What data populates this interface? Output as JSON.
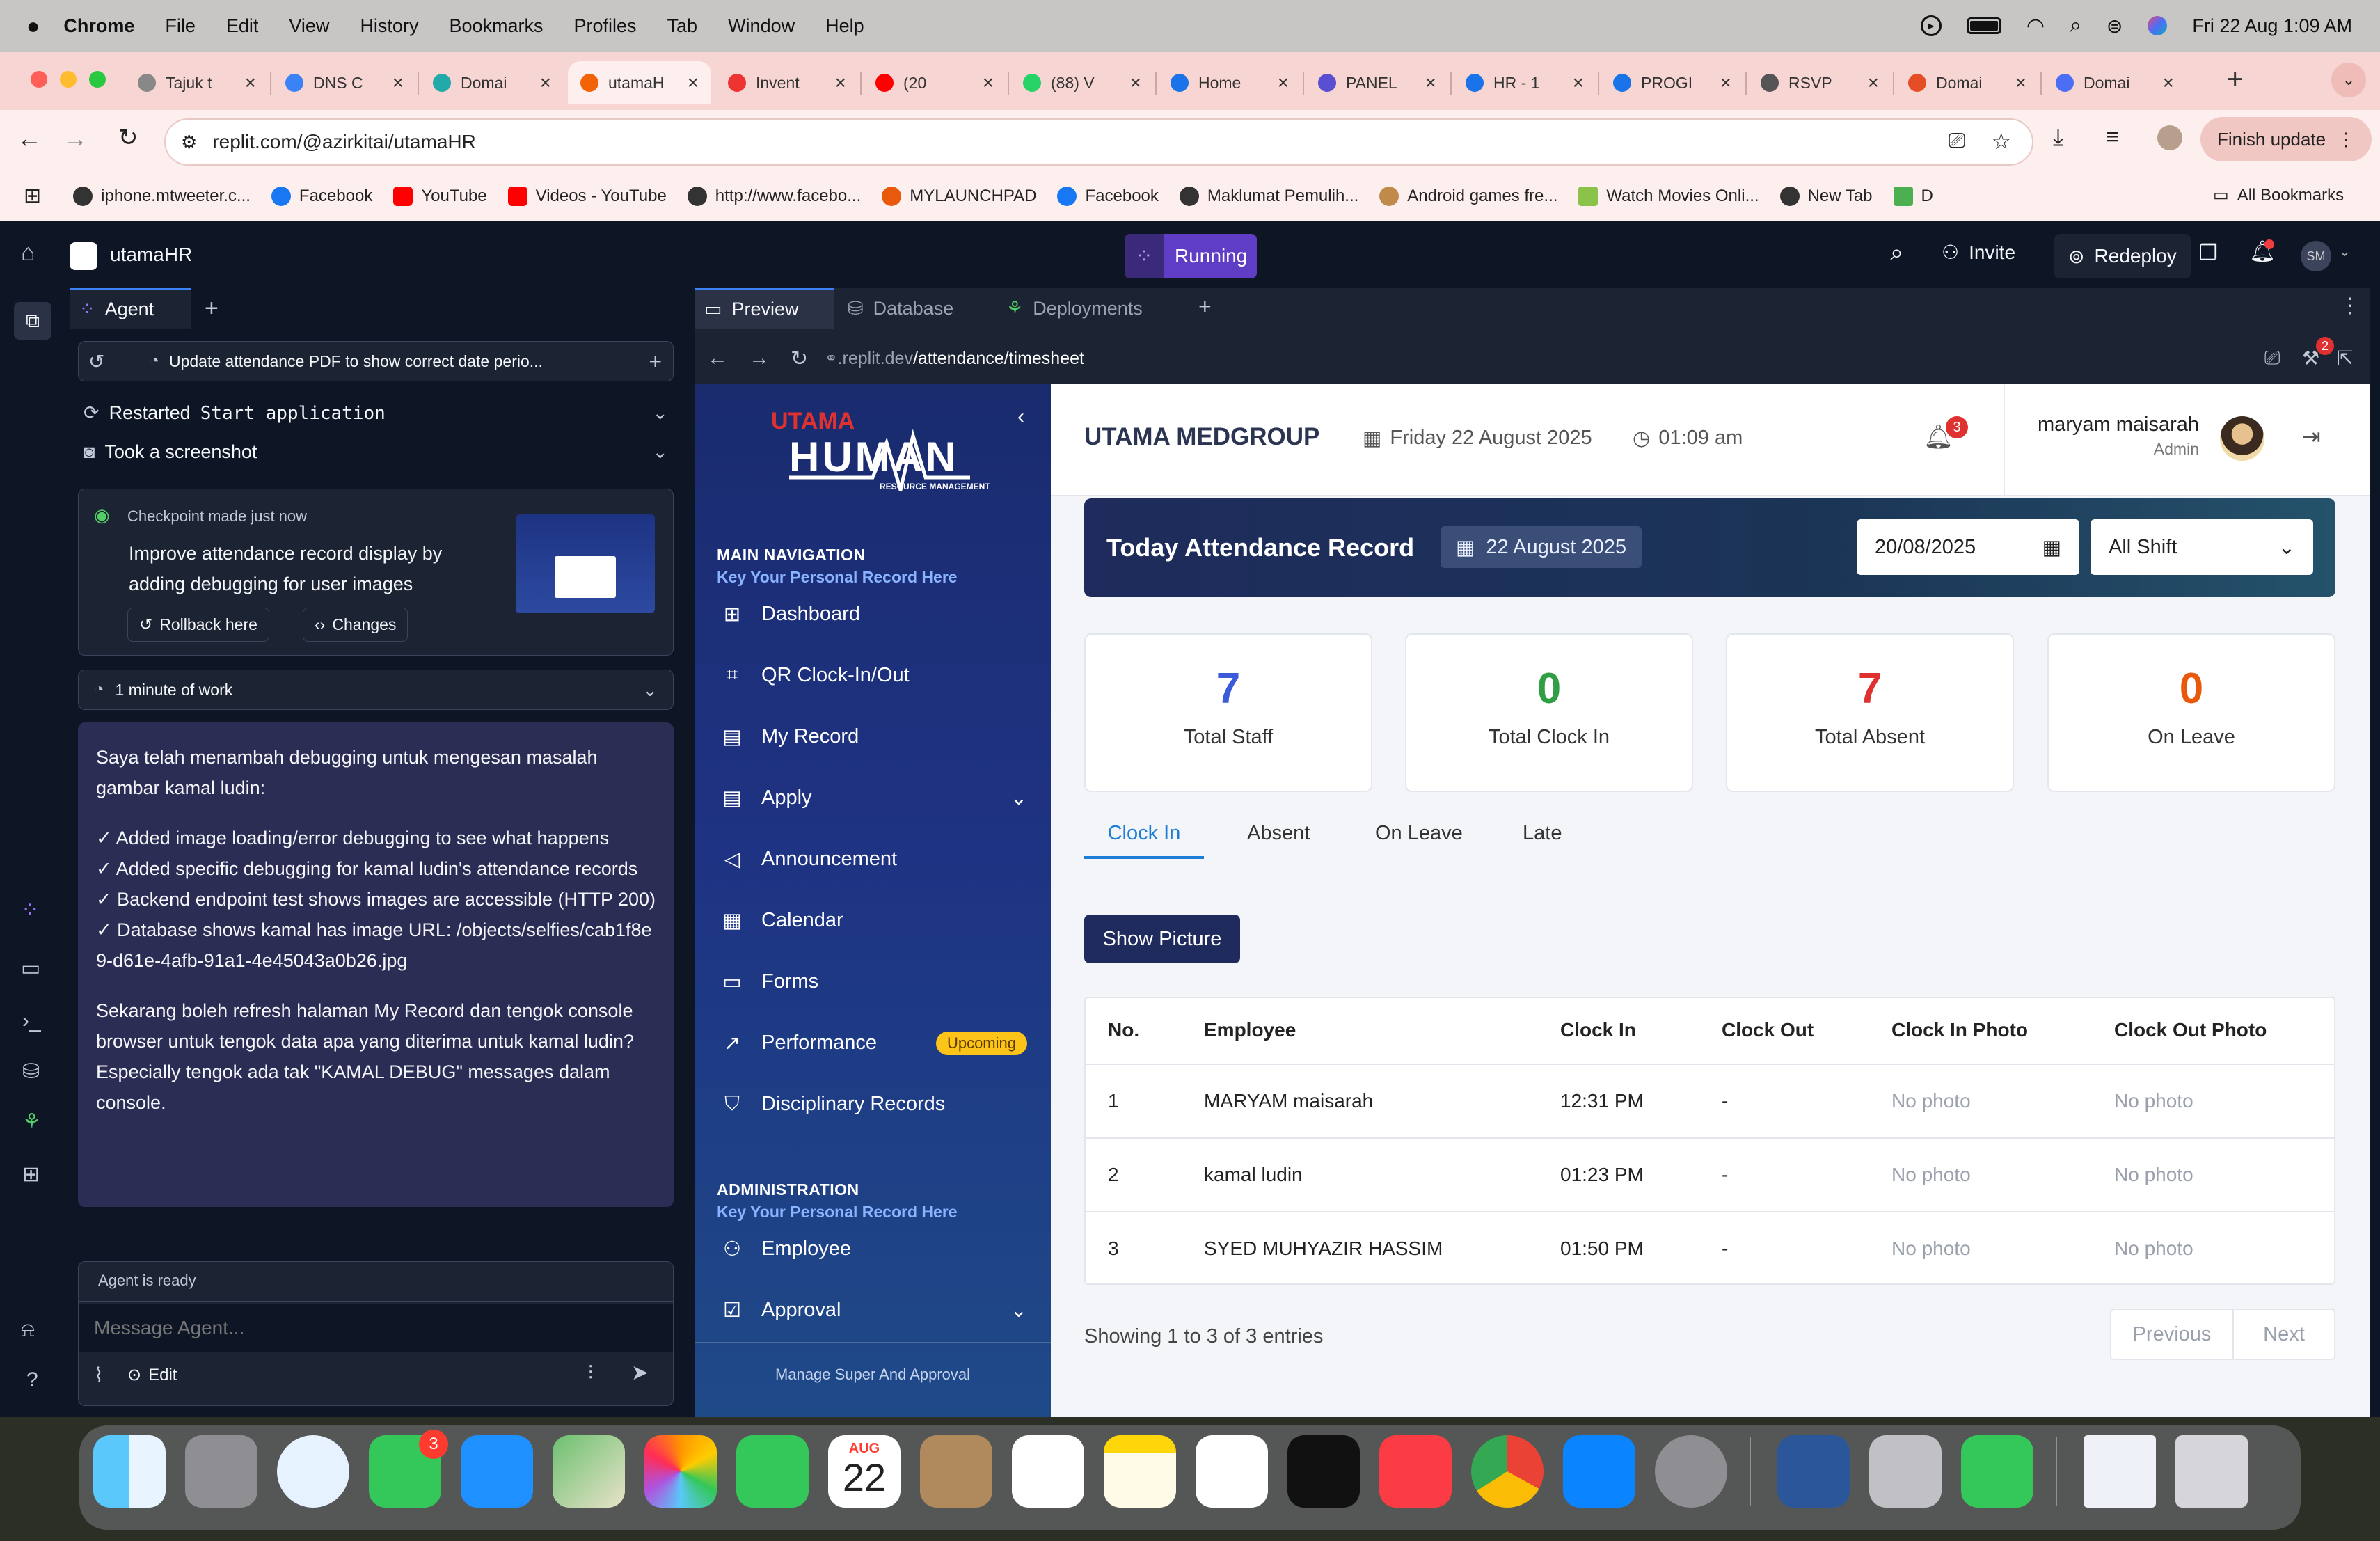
{
  "menubar": {
    "app": "Chrome",
    "items": [
      "File",
      "Edit",
      "View",
      "History",
      "Bookmarks",
      "Profiles",
      "Tab",
      "Window",
      "Help"
    ],
    "datetime": "Fri 22 Aug  1:09 AM"
  },
  "tabs": [
    {
      "title": "Tajuk t",
      "color": "#888"
    },
    {
      "title": "DNS C",
      "color": "#3b82f6"
    },
    {
      "title": "Domai",
      "color": "#2aa"
    },
    {
      "title": "utamaH",
      "color": "#f26207"
    },
    {
      "title": "Invent",
      "color": "#e33"
    },
    {
      "title": "(20",
      "color": "#f00"
    },
    {
      "title": "(88) V",
      "color": "#25d366"
    },
    {
      "title": "Home",
      "color": "#1a73e8"
    },
    {
      "title": "PANEL",
      "color": "#5b4fd1"
    },
    {
      "title": "HR - 1",
      "color": "#1a73e8"
    },
    {
      "title": "PROGI",
      "color": "#1a73e8"
    },
    {
      "title": "RSVP",
      "color": "#555"
    },
    {
      "title": "Domai",
      "color": "#e44d26"
    },
    {
      "title": "Domai",
      "color": "#4c6ef5"
    }
  ],
  "browser": {
    "url": "replit.com/@azirkitai/utamaHR",
    "finish_update": "Finish update"
  },
  "bookmarks": [
    "iphone.mtweeter.c...",
    "Facebook",
    "YouTube",
    "Videos - YouTube",
    "http://www.facebo...",
    "MYLAUNCHPAD",
    "Facebook",
    "Maklumat Pemulih...",
    "Android games fre...",
    "Watch Movies Onli...",
    "New Tab",
    "D"
  ],
  "bookmarks_all": "All Bookmarks",
  "replit": {
    "project": "utamaHR",
    "status": "Running",
    "invite": "Invite",
    "redeploy": "Redeploy",
    "avatar": "SM"
  },
  "agent": {
    "tab": "Agent",
    "title": "Update attendance PDF to show correct date perio...",
    "restarted": "Restarted",
    "restarted_cmd": "Start application",
    "screenshot": "Took a screenshot",
    "checkpoint": "Checkpoint made just now",
    "checkpoint_desc": "Improve attendance record display by adding debugging for user images",
    "rollback": "Rollback here",
    "changes": "Changes",
    "work": "1 minute of work",
    "message_p1": "Saya telah menambah debugging untuk mengesan masalah gambar kamal ludin:",
    "bullets": [
      "✓ Added image loading/error debugging to see what happens",
      "✓ Added specific debugging for kamal ludin's attendance records",
      "✓ Backend endpoint test shows images are accessible (HTTP 200)",
      "✓ Database shows kamal has image URL: /objects/selfies/cab1f8e9-d61e-4afb-91a1-4e45043a0b26.jpg"
    ],
    "message_p2": "Sekarang boleh refresh halaman My Record dan tengok console browser untuk tengok data apa yang diterima untuk kamal ludin? Especially tengok ada tak \"KAMAL DEBUG\" messages dalam console.",
    "ready": "Agent is ready",
    "placeholder": "Message Agent...",
    "edit": "Edit"
  },
  "preview": {
    "tabs": [
      "Preview",
      "Database",
      "Deployments"
    ],
    "url_prefix": ".replit.dev",
    "url_path": "/attendance/timesheet"
  },
  "app": {
    "logo_top": "UTAMA",
    "logo_main": "HUMAN",
    "logo_sub": "RESOURCE MANAGEMENT",
    "main_nav": "MAIN NAVIGATION",
    "main_nav_sub": "Key Your Personal Record Here",
    "nav": [
      "Dashboard",
      "QR Clock-In/Out",
      "My Record",
      "Apply",
      "Announcement",
      "Calendar",
      "Forms",
      "Performance",
      "Disciplinary Records"
    ],
    "upcoming": "Upcoming",
    "admin": "ADMINISTRATION",
    "admin_sub": "Key Your Personal Record Here",
    "admin_nav": [
      "Employee",
      "Approval"
    ],
    "footer_hint": "Manage Super And Approval",
    "company": "UTAMA MEDGROUP",
    "date": "Friday 22 August 2025",
    "time": "01:09 am",
    "notif": "3",
    "user_name": "maryam maisarah",
    "user_role": "Admin",
    "banner_title": "Today Attendance Record",
    "banner_date": "22 August 2025",
    "date_input": "20/08/2025",
    "shift": "All Shift",
    "stats": [
      {
        "value": "7",
        "label": "Total Staff",
        "color": "#3b5bdb"
      },
      {
        "value": "0",
        "label": "Total Clock In",
        "color": "#2f9e44"
      },
      {
        "value": "7",
        "label": "Total Absent",
        "color": "#e03131"
      },
      {
        "value": "0",
        "label": "On Leave",
        "color": "#e8590c"
      }
    ],
    "subtabs": [
      "Clock In",
      "Absent",
      "On Leave",
      "Late"
    ],
    "show_picture": "Show Picture",
    "columns": [
      "No.",
      "Employee",
      "Clock In",
      "Clock Out",
      "Clock In Photo",
      "Clock Out Photo"
    ],
    "rows": [
      [
        "1",
        "MARYAM maisarah",
        "12:31 PM",
        "-",
        "No photo",
        "No photo"
      ],
      [
        "2",
        "kamal ludin",
        "01:23 PM",
        "-",
        "No photo",
        "No photo"
      ],
      [
        "3",
        "SYED MUHYAZIR HASSIM",
        "01:50 PM",
        "-",
        "No photo",
        "No photo"
      ]
    ],
    "showing": "Showing 1 to 3 of 3 entries",
    "prev": "Previous",
    "next": "Next"
  },
  "dock": {
    "calendar_month": "AUG",
    "calendar_day": "22",
    "messages_badge": "3",
    "icons": [
      "finder-icon",
      "launchpad-icon",
      "safari-icon",
      "messages-icon",
      "mail-icon",
      "maps-icon",
      "photos-icon",
      "facetime-icon",
      "calendar-icon",
      "contacts-icon",
      "reminders-icon",
      "notes-icon",
      "freeform-icon",
      "appletv-icon",
      "music-icon",
      "chrome-icon",
      "appstore-icon",
      "settings-icon",
      "word-icon",
      "iphone-mirror-icon",
      "numbers-icon",
      "document-icon",
      "trash-icon"
    ]
  }
}
